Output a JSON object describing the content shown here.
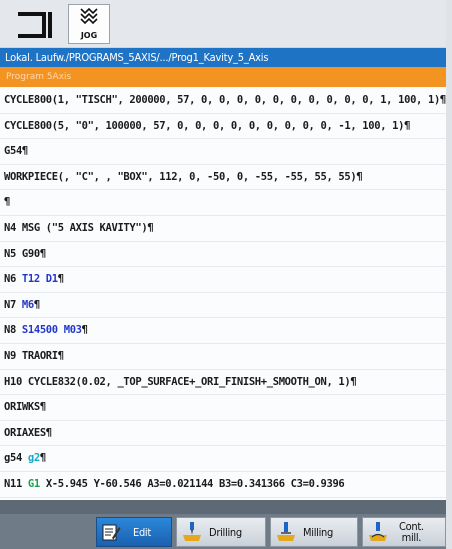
{
  "toolbar": {
    "jog_label": "JOG"
  },
  "path": "Lokal. Laufw./PROGRAMS_5AXIS/.../Prog1_Kavity_5_Axis",
  "status": "Program 5Axis",
  "program_lines": [
    [
      {
        "t": "CYCLE800(1, \"TISCH\", 200000, 57, 0, 0, 0, 0, 0, 0, 0, 0, 0, 0, 1, 100, 1)¶"
      }
    ],
    [
      {
        "t": "CYCLE800(5, \"0\", 100000, 57, 0, 0, 0, 0, 0, 0, 0, 0, 0, -1, 100, 1)¶"
      }
    ],
    [
      {
        "t": "G54¶"
      }
    ],
    [
      {
        "t": "WORKPIECE(, \"C\", , \"BOX\", 112, 0, -50, 0, -55, -55, 55, 55)¶"
      }
    ],
    [
      {
        "t": "¶"
      }
    ],
    [
      {
        "t": "N4 MSG (\"5 AXIS KAVITY\")¶"
      }
    ],
    [
      {
        "t": "N5 G90¶"
      }
    ],
    [
      {
        "t": "N6 "
      },
      {
        "t": "T12  D1",
        "c": "blue"
      },
      {
        "t": "¶"
      }
    ],
    [
      {
        "t": "N7 "
      },
      {
        "t": "M6",
        "c": "blue"
      },
      {
        "t": "¶"
      }
    ],
    [
      {
        "t": "N8 "
      },
      {
        "t": "S14500 M03",
        "c": "blue"
      },
      {
        "t": "¶"
      }
    ],
    [
      {
        "t": "N9 TRAORI¶"
      }
    ],
    [
      {
        "t": "H10 CYCLE832(0.02, _TOP_SURFACE+_ORI_FINISH+_SMOOTH_ON, 1)¶"
      }
    ],
    [
      {
        "t": "ORIWKS¶"
      }
    ],
    [
      {
        "t": "ORIAXES¶"
      }
    ],
    [
      {
        "t": "g54 "
      },
      {
        "t": "g2",
        "c": "cyan"
      },
      {
        "t": "¶"
      }
    ],
    [
      {
        "t": "N11 "
      },
      {
        "t": "G1",
        "c": "green"
      },
      {
        "t": " X-5.945 Y-60.546 A3=0.021144 B3=0.341366 C3=0.9396"
      }
    ]
  ],
  "softkeys": {
    "edit": "Edit",
    "drilling": "Drilling",
    "milling": "Milling",
    "cont_mill_1": "Cont.",
    "cont_mill_2": "mill."
  },
  "colors": {
    "path_bar": "#1f73c4",
    "status_bar": "#f39422",
    "keyword_blue": "#2338c8",
    "keyword_green": "#1aa14a",
    "keyword_cyan": "#14a9c9"
  },
  "icons": [
    "bracket-icon",
    "jog-icon",
    "edit-icon",
    "drilling-icon",
    "milling-icon",
    "cont-mill-icon"
  ]
}
